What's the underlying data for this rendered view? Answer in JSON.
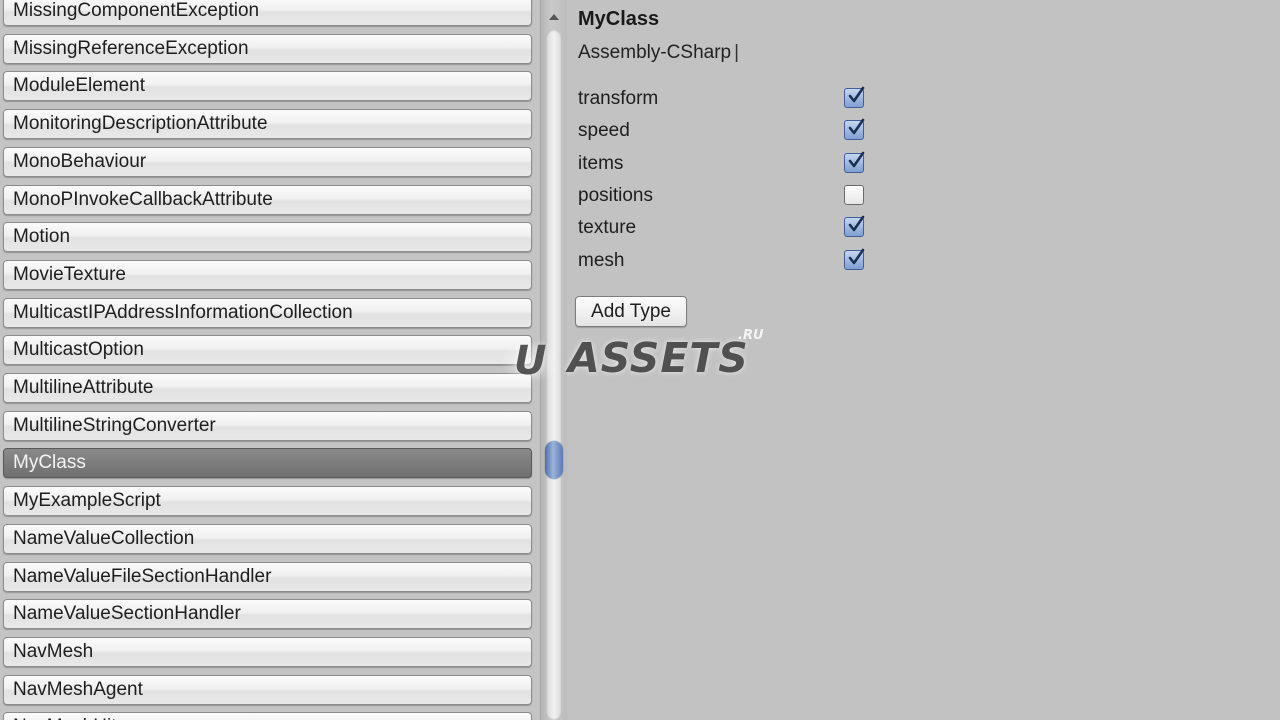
{
  "type_list": {
    "items": [
      {
        "label": "MissingComponentException",
        "selected": false
      },
      {
        "label": "MissingReferenceException",
        "selected": false
      },
      {
        "label": "ModuleElement",
        "selected": false
      },
      {
        "label": "MonitoringDescriptionAttribute",
        "selected": false
      },
      {
        "label": "MonoBehaviour",
        "selected": false
      },
      {
        "label": "MonoPInvokeCallbackAttribute",
        "selected": false
      },
      {
        "label": "Motion",
        "selected": false
      },
      {
        "label": "MovieTexture",
        "selected": false
      },
      {
        "label": "MulticastIPAddressInformationCollection",
        "selected": false
      },
      {
        "label": "MulticastOption",
        "selected": false
      },
      {
        "label": "MultilineAttribute",
        "selected": false
      },
      {
        "label": "MultilineStringConverter",
        "selected": false
      },
      {
        "label": "MyClass",
        "selected": true
      },
      {
        "label": "MyExampleScript",
        "selected": false
      },
      {
        "label": "NameValueCollection",
        "selected": false
      },
      {
        "label": "NameValueFileSectionHandler",
        "selected": false
      },
      {
        "label": "NameValueSectionHandler",
        "selected": false
      },
      {
        "label": "NavMesh",
        "selected": false
      },
      {
        "label": "NavMeshAgent",
        "selected": false
      },
      {
        "label": "NavMeshHit",
        "selected": false
      }
    ]
  },
  "inspector": {
    "class_name": "MyClass",
    "assembly": "Assembly-CSharp",
    "assembly_separator": "|",
    "fields": [
      {
        "name": "transform",
        "checked": true
      },
      {
        "name": "speed",
        "checked": true
      },
      {
        "name": "items",
        "checked": true
      },
      {
        "name": "positions",
        "checked": false
      },
      {
        "name": "texture",
        "checked": true
      },
      {
        "name": "mesh",
        "checked": true
      }
    ],
    "add_type_label": "Add Type"
  },
  "watermark": {
    "letter": "U",
    "text": "ASSETS",
    "suffix": ".RU"
  },
  "colors": {
    "panel_bg": "#c2c2c2",
    "selected_item_bg": "#7a7a7a",
    "checkbox_accent": "#7f9ed2",
    "scroll_thumb": "#6f8fc4"
  }
}
